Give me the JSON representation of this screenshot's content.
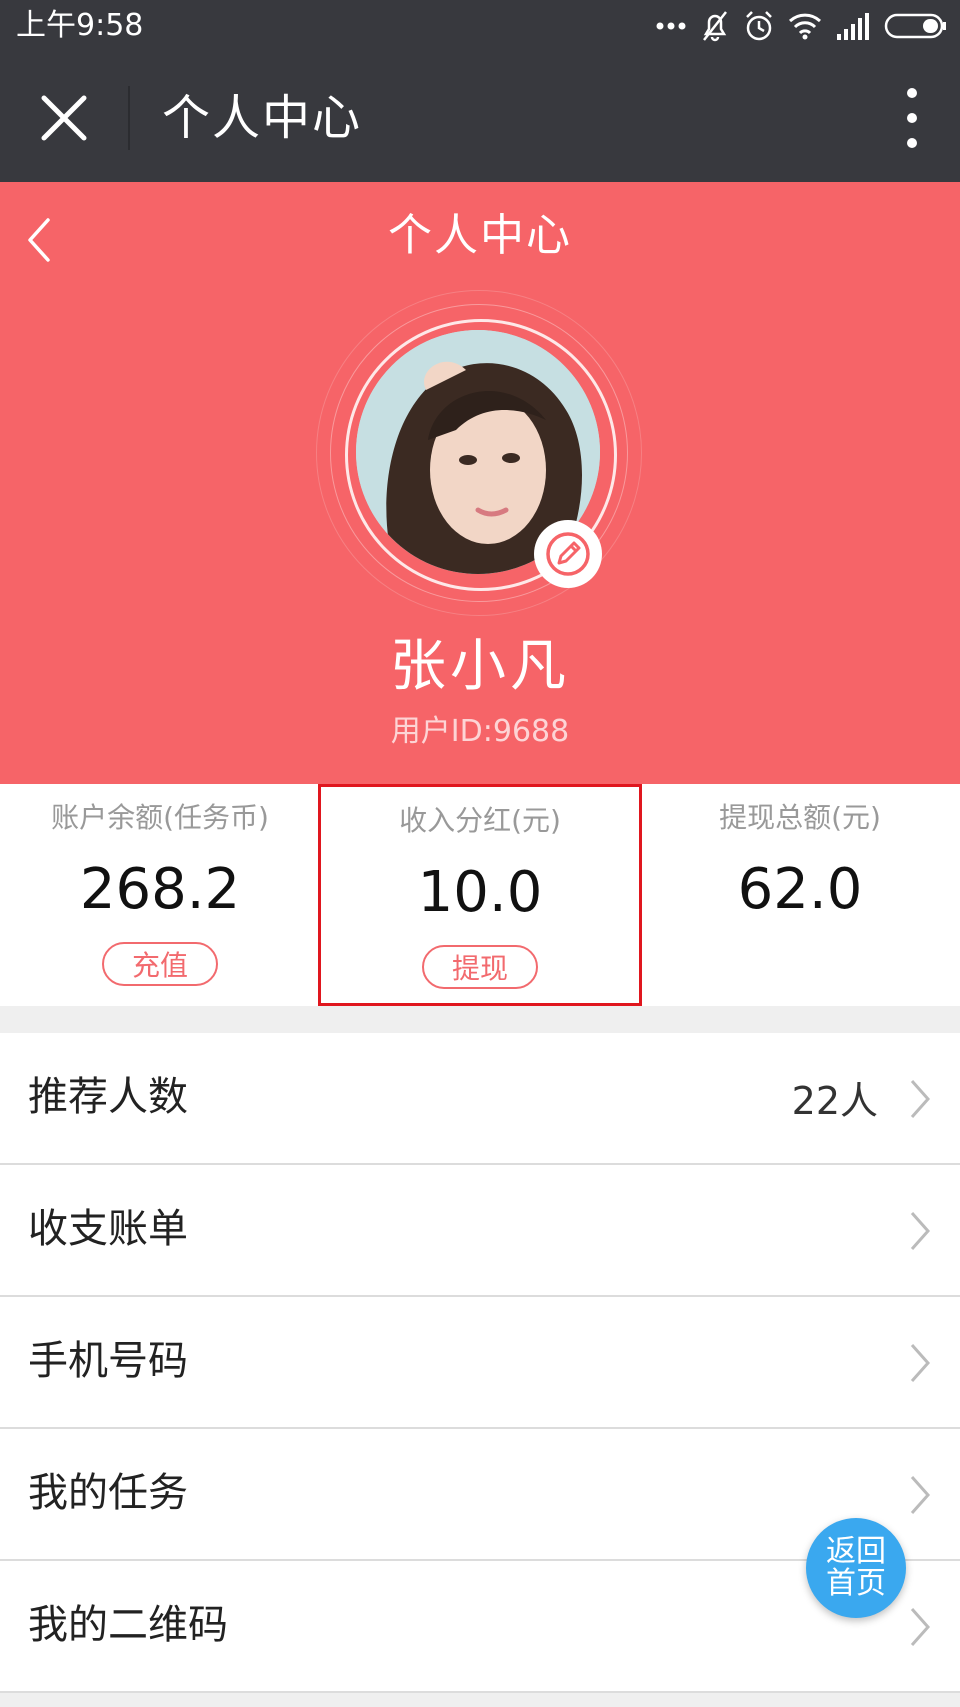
{
  "status_bar": {
    "time": "上午9:58",
    "icons": [
      "more-dots-icon",
      "bell-muted-icon",
      "alarm-clock-icon",
      "wifi-icon",
      "signal-icon",
      "battery-icon"
    ]
  },
  "title_bar": {
    "title": "个人中心",
    "close_icon": "close-icon",
    "more_icon": "more-vertical-icon"
  },
  "profile": {
    "page_title": "个人中心",
    "name": "张小凡",
    "user_id": "用户ID:9688",
    "avatar_icon": "avatar-photo",
    "edit_icon": "edit-pencil-icon"
  },
  "stats": [
    {
      "label": "账户余额(任务币)",
      "value": "268.2",
      "button": "充值"
    },
    {
      "label": "收入分红(元)",
      "value": "10.0",
      "button": "提现"
    },
    {
      "label": "提现总额(元)",
      "value": "62.0"
    }
  ],
  "menu": [
    {
      "label": "推荐人数",
      "value": "22人"
    },
    {
      "label": "收支账单"
    },
    {
      "label": "手机号码"
    },
    {
      "label": "我的任务"
    },
    {
      "label": "我的二维码"
    }
  ],
  "home_button": {
    "line1": "返回",
    "line2": "首页"
  },
  "colors": {
    "brand_red": "#f66468",
    "title_bar": "#38393e",
    "highlight_border": "#e0161e",
    "home_button": "#3aa8ef"
  }
}
